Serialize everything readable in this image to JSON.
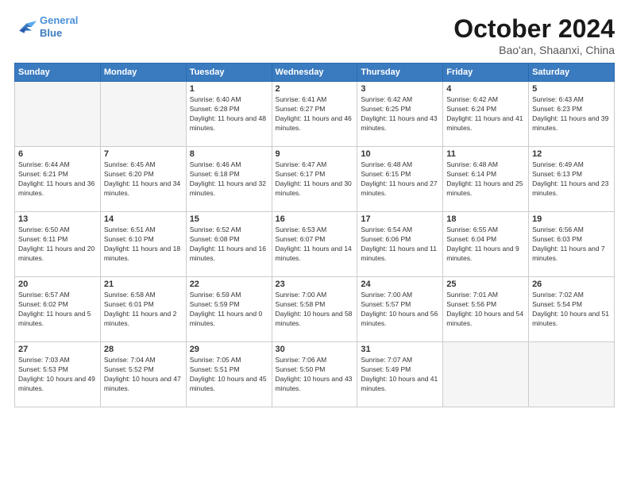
{
  "logo": {
    "line1": "General",
    "line2": "Blue"
  },
  "title": "October 2024",
  "location": "Bao'an, Shaanxi, China",
  "days_of_week": [
    "Sunday",
    "Monday",
    "Tuesday",
    "Wednesday",
    "Thursday",
    "Friday",
    "Saturday"
  ],
  "weeks": [
    [
      {
        "day": "",
        "info": ""
      },
      {
        "day": "",
        "info": ""
      },
      {
        "day": "1",
        "info": "Sunrise: 6:40 AM\nSunset: 6:28 PM\nDaylight: 11 hours and 48 minutes."
      },
      {
        "day": "2",
        "info": "Sunrise: 6:41 AM\nSunset: 6:27 PM\nDaylight: 11 hours and 46 minutes."
      },
      {
        "day": "3",
        "info": "Sunrise: 6:42 AM\nSunset: 6:25 PM\nDaylight: 11 hours and 43 minutes."
      },
      {
        "day": "4",
        "info": "Sunrise: 6:42 AM\nSunset: 6:24 PM\nDaylight: 11 hours and 41 minutes."
      },
      {
        "day": "5",
        "info": "Sunrise: 6:43 AM\nSunset: 6:23 PM\nDaylight: 11 hours and 39 minutes."
      }
    ],
    [
      {
        "day": "6",
        "info": "Sunrise: 6:44 AM\nSunset: 6:21 PM\nDaylight: 11 hours and 36 minutes."
      },
      {
        "day": "7",
        "info": "Sunrise: 6:45 AM\nSunset: 6:20 PM\nDaylight: 11 hours and 34 minutes."
      },
      {
        "day": "8",
        "info": "Sunrise: 6:46 AM\nSunset: 6:18 PM\nDaylight: 11 hours and 32 minutes."
      },
      {
        "day": "9",
        "info": "Sunrise: 6:47 AM\nSunset: 6:17 PM\nDaylight: 11 hours and 30 minutes."
      },
      {
        "day": "10",
        "info": "Sunrise: 6:48 AM\nSunset: 6:15 PM\nDaylight: 11 hours and 27 minutes."
      },
      {
        "day": "11",
        "info": "Sunrise: 6:48 AM\nSunset: 6:14 PM\nDaylight: 11 hours and 25 minutes."
      },
      {
        "day": "12",
        "info": "Sunrise: 6:49 AM\nSunset: 6:13 PM\nDaylight: 11 hours and 23 minutes."
      }
    ],
    [
      {
        "day": "13",
        "info": "Sunrise: 6:50 AM\nSunset: 6:11 PM\nDaylight: 11 hours and 20 minutes."
      },
      {
        "day": "14",
        "info": "Sunrise: 6:51 AM\nSunset: 6:10 PM\nDaylight: 11 hours and 18 minutes."
      },
      {
        "day": "15",
        "info": "Sunrise: 6:52 AM\nSunset: 6:08 PM\nDaylight: 11 hours and 16 minutes."
      },
      {
        "day": "16",
        "info": "Sunrise: 6:53 AM\nSunset: 6:07 PM\nDaylight: 11 hours and 14 minutes."
      },
      {
        "day": "17",
        "info": "Sunrise: 6:54 AM\nSunset: 6:06 PM\nDaylight: 11 hours and 11 minutes."
      },
      {
        "day": "18",
        "info": "Sunrise: 6:55 AM\nSunset: 6:04 PM\nDaylight: 11 hours and 9 minutes."
      },
      {
        "day": "19",
        "info": "Sunrise: 6:56 AM\nSunset: 6:03 PM\nDaylight: 11 hours and 7 minutes."
      }
    ],
    [
      {
        "day": "20",
        "info": "Sunrise: 6:57 AM\nSunset: 6:02 PM\nDaylight: 11 hours and 5 minutes."
      },
      {
        "day": "21",
        "info": "Sunrise: 6:58 AM\nSunset: 6:01 PM\nDaylight: 11 hours and 2 minutes."
      },
      {
        "day": "22",
        "info": "Sunrise: 6:59 AM\nSunset: 5:59 PM\nDaylight: 11 hours and 0 minutes."
      },
      {
        "day": "23",
        "info": "Sunrise: 7:00 AM\nSunset: 5:58 PM\nDaylight: 10 hours and 58 minutes."
      },
      {
        "day": "24",
        "info": "Sunrise: 7:00 AM\nSunset: 5:57 PM\nDaylight: 10 hours and 56 minutes."
      },
      {
        "day": "25",
        "info": "Sunrise: 7:01 AM\nSunset: 5:56 PM\nDaylight: 10 hours and 54 minutes."
      },
      {
        "day": "26",
        "info": "Sunrise: 7:02 AM\nSunset: 5:54 PM\nDaylight: 10 hours and 51 minutes."
      }
    ],
    [
      {
        "day": "27",
        "info": "Sunrise: 7:03 AM\nSunset: 5:53 PM\nDaylight: 10 hours and 49 minutes."
      },
      {
        "day": "28",
        "info": "Sunrise: 7:04 AM\nSunset: 5:52 PM\nDaylight: 10 hours and 47 minutes."
      },
      {
        "day": "29",
        "info": "Sunrise: 7:05 AM\nSunset: 5:51 PM\nDaylight: 10 hours and 45 minutes."
      },
      {
        "day": "30",
        "info": "Sunrise: 7:06 AM\nSunset: 5:50 PM\nDaylight: 10 hours and 43 minutes."
      },
      {
        "day": "31",
        "info": "Sunrise: 7:07 AM\nSunset: 5:49 PM\nDaylight: 10 hours and 41 minutes."
      },
      {
        "day": "",
        "info": ""
      },
      {
        "day": "",
        "info": ""
      }
    ]
  ]
}
